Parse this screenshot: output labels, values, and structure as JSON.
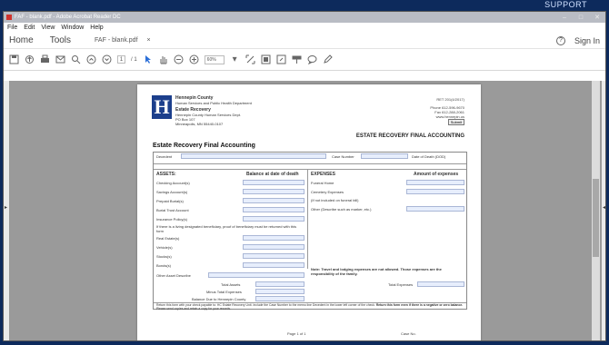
{
  "app": {
    "window_title": "FAF - blank.pdf - Adobe Acrobat Reader DC",
    "overlay_text": "SUPPORT"
  },
  "menu": [
    "File",
    "Edit",
    "View",
    "Window",
    "Help"
  ],
  "tabs": {
    "home": "Home",
    "tools": "Tools",
    "doc_tab": "FAF - blank.pdf",
    "close": "×",
    "help": "?",
    "sign_in": "Sign In"
  },
  "toolbar": {
    "page_current": "1",
    "page_total": "/ 1",
    "zoom": "60%"
  },
  "document": {
    "org_name": "Hennepin County",
    "org_dept": "Human Services and Public Health Department",
    "unit": "Estate Recovery",
    "unit_sub": "Hennepin County Human Services Dept.",
    "address1": "PO Box 107",
    "address2": "Minneapolis, MN 55440-0107",
    "form_code": "RET 201(4/2017)",
    "phone": "Phone 612-596-9670",
    "fax": "Fax 612-288-2061",
    "web": "www.hennepin.us",
    "submit": "Submit",
    "form_title": "ESTATE RECOVERY FINAL ACCOUNTING",
    "section_title": "Estate Recovery Final Accounting",
    "decedent_label": "Decedent",
    "case_number_label": "Case Number",
    "date_of_death_label": "Date of Death (DOD)",
    "assets_header": "ASSETS:",
    "balance_header": "Balance at date of death",
    "expenses_header": "EXPENSES",
    "amount_header": "Amount of expenses",
    "assets": [
      "Checking Account(s)",
      "Savings Account(s)",
      "Prepaid Burial(s)",
      "Burial Trust Account",
      "Insurance Policy(s)",
      "If there is a living designated beneficiary, proof of beneficiary must be returned with this form",
      "Real Estate(s)",
      "Vehicle(s)",
      "Stocks(s)",
      "Bonds(s)",
      "Other Asset Describe"
    ],
    "expenses": [
      "Funeral Home",
      "Cemetery Expenses",
      "(If not included on funeral bill)",
      "Other   (Describe such as marker, etc.)"
    ],
    "note": "Note: Travel and lodging expenses are not allowed.  Those expenses are the responsibility of the family.",
    "total_assets": "Total Assets",
    "minus_total_expenses": "Minus Total Expenses",
    "balance_due": "Balance Due to Hennepin County",
    "total_expenses": "Total Expenses",
    "return_note": "Return this form with your check payable to: HC Estate Recovery Unit. Include the Case Number to the memo line Decedent in the lower left corner of the check.",
    "return_note_bold": "Return this form even if there is a negative or zero balance.",
    "return_note_tail": "Please send copies and retain a copy for your records.",
    "page_label": "Page 1 of 1",
    "case_no_label": "Case No."
  }
}
